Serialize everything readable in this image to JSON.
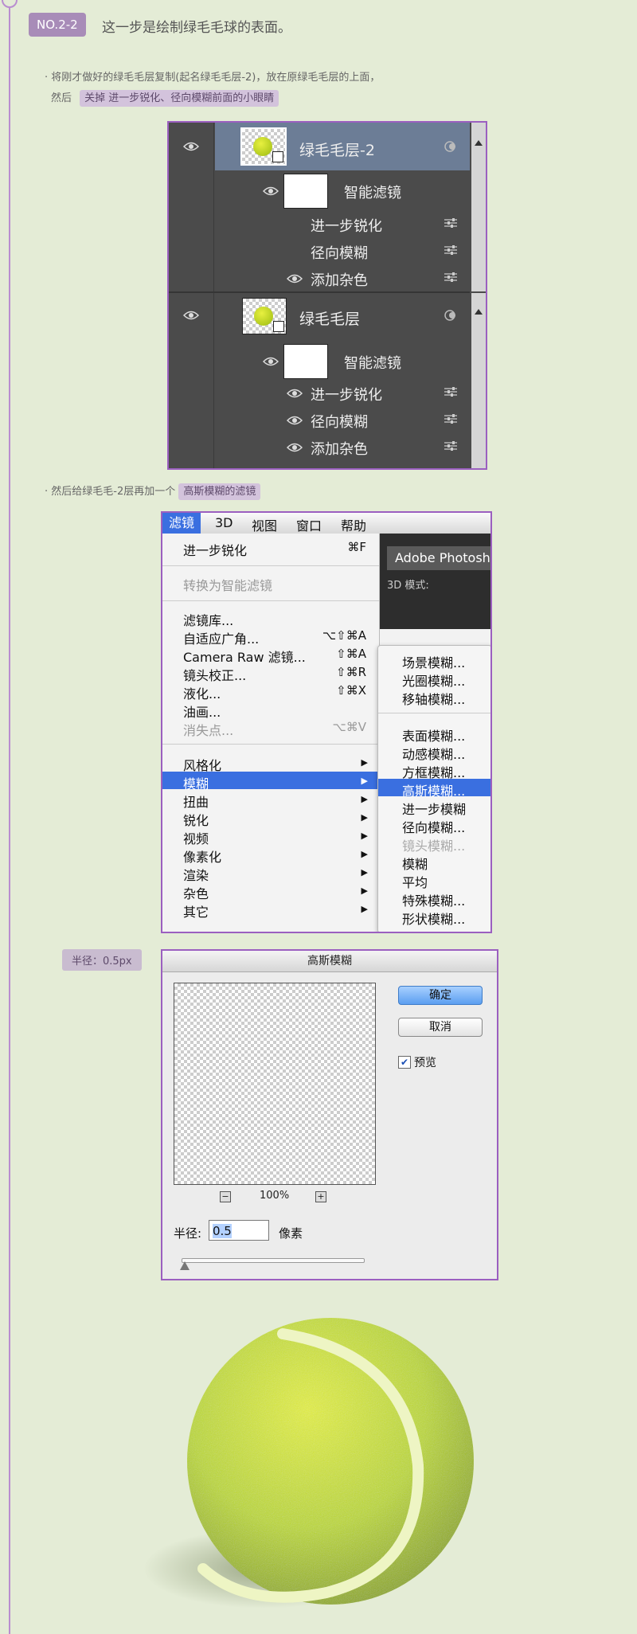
{
  "header": {
    "step_badge": "NO.2-2",
    "step_title": "这一步是绘制绿毛毛球的表面。"
  },
  "notes": {
    "line1": "· 将刚才做好的绿毛毛层复制(起名绿毛毛层-2)，放在原绿毛毛层的上面，",
    "line2_prefix": "然后",
    "line2_highlight": "关掉 进一步锐化、径向模糊前面的小眼睛",
    "line3_prefix": "· 然后给绿毛毛-2层再加一个",
    "line3_highlight": "高斯模糊的滤镜",
    "radius_tag": "半径：0.5px"
  },
  "layers_panel": {
    "layer1": {
      "name": "绿毛毛层-2",
      "smart_filter": "智能滤镜",
      "filters": [
        "进一步锐化",
        "径向模糊",
        "添加杂色"
      ]
    },
    "layer2": {
      "name": "绿毛毛层",
      "smart_filter": "智能滤镜",
      "filters": [
        "进一步锐化",
        "径向模糊",
        "添加杂色"
      ]
    }
  },
  "menu": {
    "menubar": [
      "滤镜",
      "3D",
      "视图",
      "窗口",
      "帮助"
    ],
    "filter_items": [
      {
        "label": "进一步锐化",
        "shortcut": "⌘F"
      },
      {
        "label": "转换为智能滤镜",
        "shortcut": ""
      },
      {
        "label": "滤镜库...",
        "shortcut": ""
      },
      {
        "label": "自适应广角...",
        "shortcut": "⌥⇧⌘A"
      },
      {
        "label": "Camera Raw 滤镜...",
        "shortcut": "⇧⌘A"
      },
      {
        "label": "镜头校正...",
        "shortcut": "⇧⌘R"
      },
      {
        "label": "液化...",
        "shortcut": "⇧⌘X"
      },
      {
        "label": "油画...",
        "shortcut": ""
      },
      {
        "label": "消失点...",
        "shortcut": "⌥⌘V"
      },
      {
        "label": "风格化",
        "shortcut": ""
      },
      {
        "label": "模糊",
        "shortcut": ""
      },
      {
        "label": "扭曲",
        "shortcut": ""
      },
      {
        "label": "锐化",
        "shortcut": ""
      },
      {
        "label": "视频",
        "shortcut": ""
      },
      {
        "label": "像素化",
        "shortcut": ""
      },
      {
        "label": "渲染",
        "shortcut": ""
      },
      {
        "label": "杂色",
        "shortcut": ""
      },
      {
        "label": "其它",
        "shortcut": ""
      }
    ],
    "blur_submenu": [
      "场景模糊...",
      "光圈模糊...",
      "移轴模糊...",
      "表面模糊...",
      "动感模糊...",
      "方框模糊...",
      "高斯模糊...",
      "进一步模糊",
      "径向模糊...",
      "镜头模糊...",
      "模糊",
      "平均",
      "特殊模糊...",
      "形状模糊..."
    ],
    "app_title": "Adobe Photoshop",
    "mode_3d": "3D 模式:"
  },
  "dialog": {
    "title": "高斯模糊",
    "ok": "确定",
    "cancel": "取消",
    "preview_label": "预览",
    "preview_checked": true,
    "zoom": "100%",
    "zoom_out": "−",
    "zoom_in": "+",
    "radius_label": "半径:",
    "radius_value": "0.5",
    "radius_unit": "像素"
  },
  "icons": {
    "eye": "eye-icon",
    "filter_settings": "filter-settings-icon",
    "smart_object": "smart-object-icon",
    "checkmark": "checkmark-icon"
  },
  "colors": {
    "background": "#e4ecd6",
    "accent_purple": "#9b5fc0",
    "menu_highlight": "#3a6fe0",
    "ball_green": "#c8e030"
  }
}
